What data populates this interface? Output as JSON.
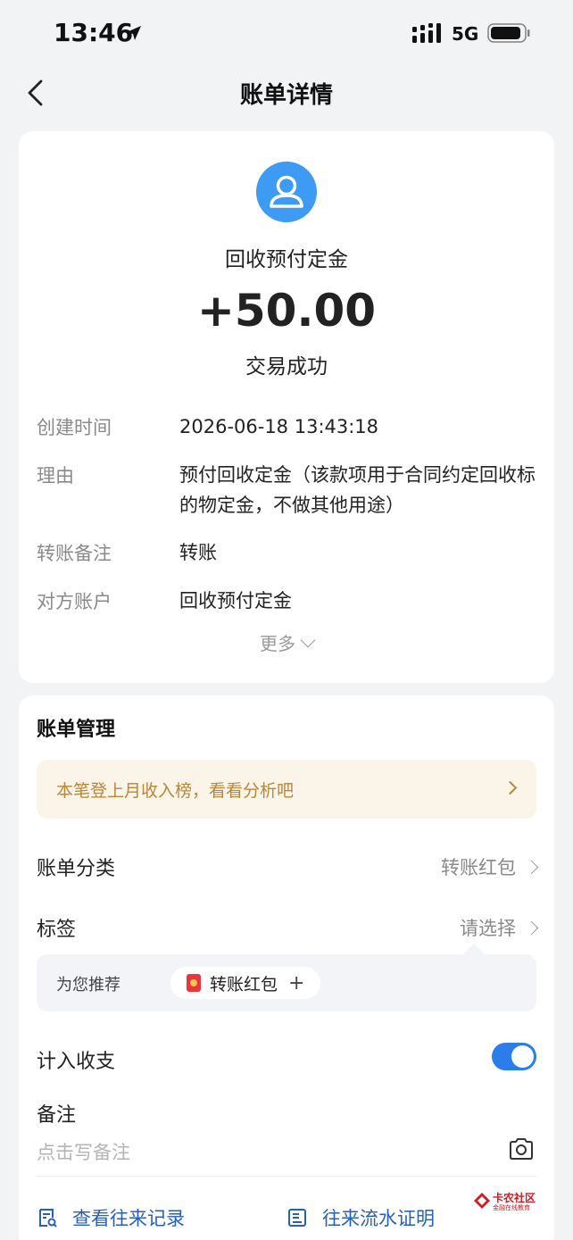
{
  "status_bar": {
    "time": "13:46",
    "network": "5G"
  },
  "nav": {
    "title": "账单详情"
  },
  "transaction": {
    "payee": "回收预付定金",
    "amount": "+50.00",
    "status": "交易成功",
    "details": [
      {
        "label": "创建时间",
        "value": "2026-06-18 13:43:18"
      },
      {
        "label": "理由",
        "value": "预付回收定金（该款项用于合同约定回收标的物定金，不做其他用途）"
      },
      {
        "label": "转账备注",
        "value": "转账"
      },
      {
        "label": "对方账户",
        "value": "回收预付定金"
      }
    ],
    "more_label": "更多"
  },
  "management": {
    "title": "账单管理",
    "banner": "本笔登上月收入榜，看看分析吧",
    "category_label": "账单分类",
    "category_value": "转账红包",
    "tag_label": "标签",
    "tag_value": "请选择",
    "recommend_label": "为您推荐",
    "recommend_chip": "转账红包",
    "count_label": "计入收支",
    "count_enabled": true,
    "note_label": "备注",
    "note_placeholder": "点击写备注",
    "link_history": "查看往来记录",
    "link_proof": "往来流水证明"
  },
  "watermark": {
    "line1": "卡农社区",
    "line2": "金融在线教育"
  },
  "colors": {
    "accent": "#2b7de9",
    "avatar": "#3d9bf4",
    "banner_text": "#b9863a",
    "link": "#2a5fb8"
  }
}
